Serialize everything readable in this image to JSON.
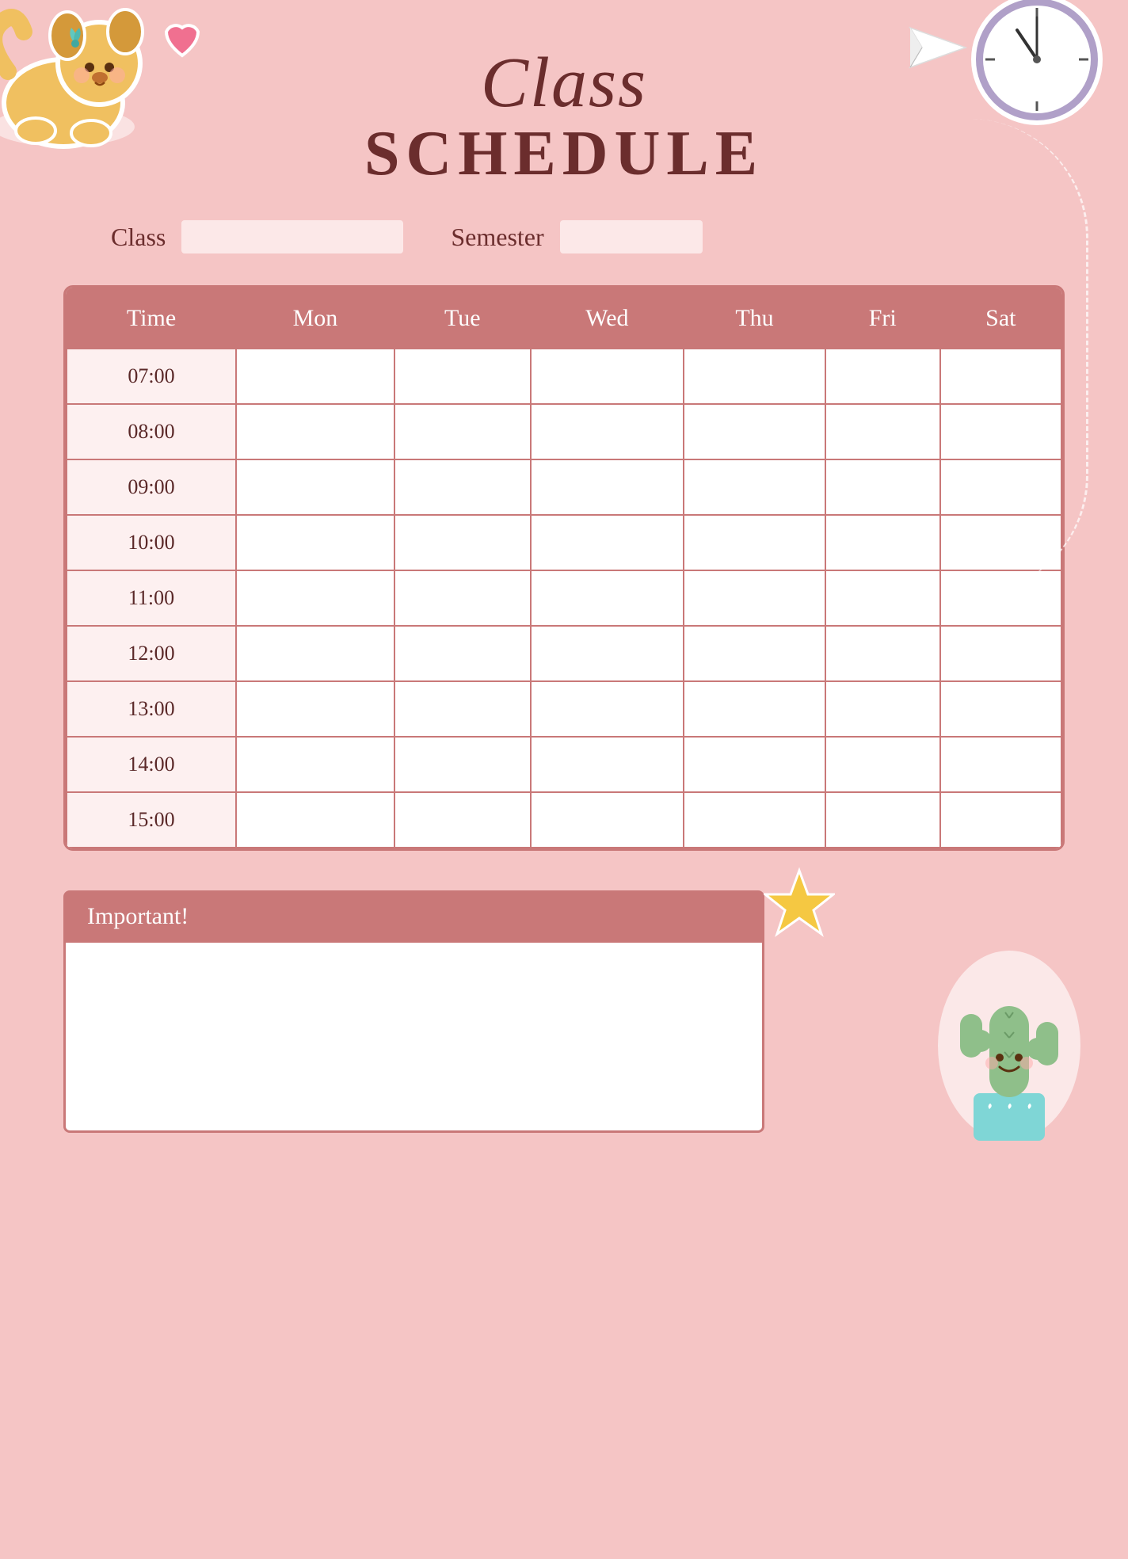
{
  "page": {
    "background_color": "#f5c5c5",
    "title_line1": "Class",
    "title_line2": "SCHEDULE"
  },
  "fields": {
    "class_label": "Class",
    "semester_label": "Semester"
  },
  "table": {
    "headers": [
      "Time",
      "Mon",
      "Tue",
      "Wed",
      "Thu",
      "Fri",
      "Sat"
    ],
    "times": [
      "07:00",
      "08:00",
      "09:00",
      "10:00",
      "11:00",
      "12:00",
      "13:00",
      "14:00",
      "15:00"
    ]
  },
  "important": {
    "header": "Important!"
  },
  "colors": {
    "dark_red": "#6b2d2d",
    "salmon": "#c97878",
    "light_pink": "#f5c5c5",
    "lighter_pink": "#fce8e8",
    "white": "#ffffff",
    "clock_border": "#b0a0c8",
    "star_yellow": "#f5c842",
    "cactus_green": "#8fbf8a",
    "cactus_pot": "#7fd6d6"
  }
}
